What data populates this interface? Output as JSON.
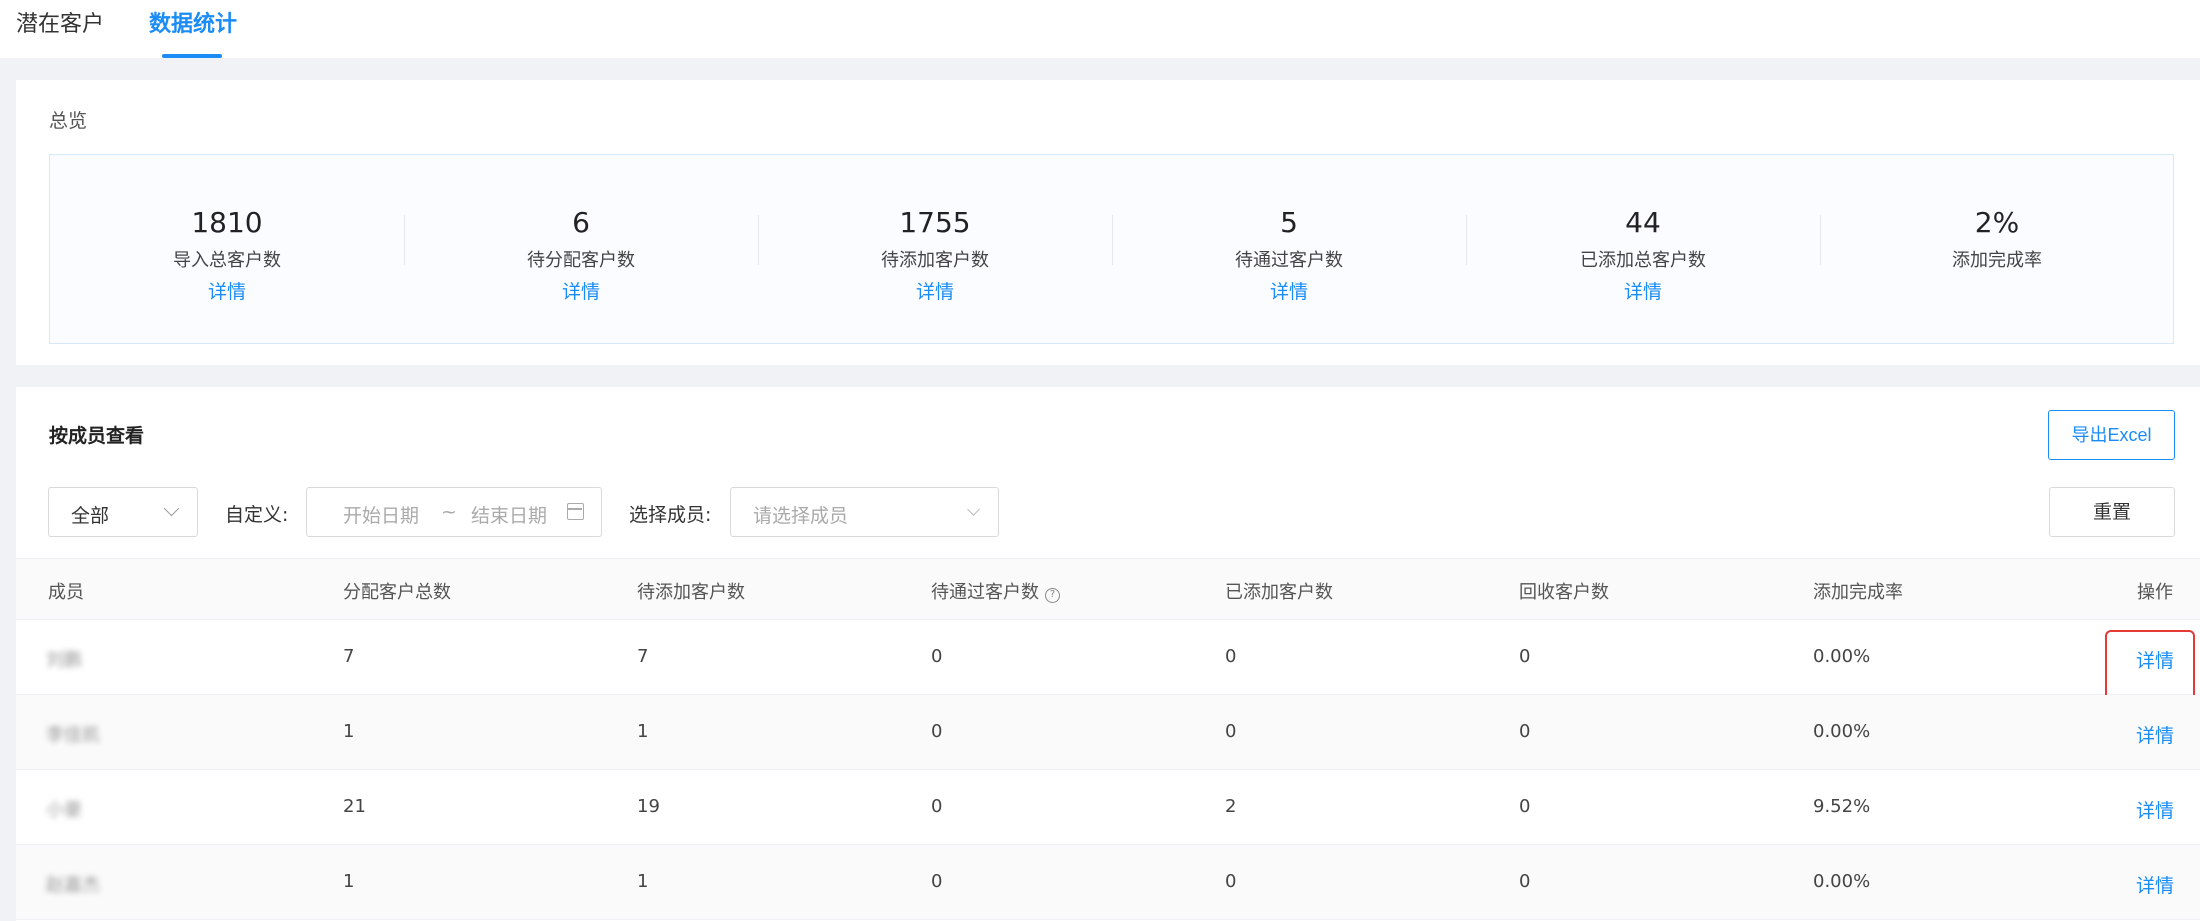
{
  "tabs": [
    {
      "label": "潜在客户",
      "active": false
    },
    {
      "label": "数据统计",
      "active": true
    }
  ],
  "overview": {
    "title": "总览",
    "stats": [
      {
        "value": "1810",
        "label": "导入总客户数",
        "link": "详情"
      },
      {
        "value": "6",
        "label": "待分配客户数",
        "link": "详情"
      },
      {
        "value": "1755",
        "label": "待添加客户数",
        "link": "详情"
      },
      {
        "value": "5",
        "label": "待通过客户数",
        "link": "详情"
      },
      {
        "value": "44",
        "label": "已添加总客户数",
        "link": "详情"
      },
      {
        "value": "2%",
        "label": "添加完成率"
      }
    ]
  },
  "member_view": {
    "title": "按成员查看",
    "export_label": "导出Excel",
    "scope_select_value": "全部",
    "custom_label": "自定义:",
    "start_placeholder": "开始日期",
    "range_sep": "~",
    "end_placeholder": "结束日期",
    "member_label": "选择成员:",
    "member_placeholder": "请选择成员",
    "reset_label": "重置"
  },
  "table": {
    "headers": [
      "成员",
      "分配客户总数",
      "待添加客户数",
      "待通过客户数",
      "已添加客户数",
      "回收客户数",
      "添加完成率",
      "操作"
    ],
    "help_icon_glyph": "?",
    "rows": [
      {
        "name": "刘鹏",
        "assigned": "7",
        "pending_add": "7",
        "pending_pass": "0",
        "added": "0",
        "recycled": "0",
        "rate": "0.00%",
        "action": "详情"
      },
      {
        "name": "李佳凯",
        "assigned": "1",
        "pending_add": "1",
        "pending_pass": "0",
        "added": "0",
        "recycled": "0",
        "rate": "0.00%",
        "action": "详情"
      },
      {
        "name": "小豪",
        "assigned": "21",
        "pending_add": "19",
        "pending_pass": "0",
        "added": "2",
        "recycled": "0",
        "rate": "9.52%",
        "action": "详情"
      },
      {
        "name": "赵嘉杰",
        "assigned": "1",
        "pending_add": "1",
        "pending_pass": "0",
        "added": "0",
        "recycled": "0",
        "rate": "0.00%",
        "action": "详情"
      }
    ]
  },
  "colors": {
    "accent": "#1a8cf5",
    "highlight": "#e53935"
  }
}
